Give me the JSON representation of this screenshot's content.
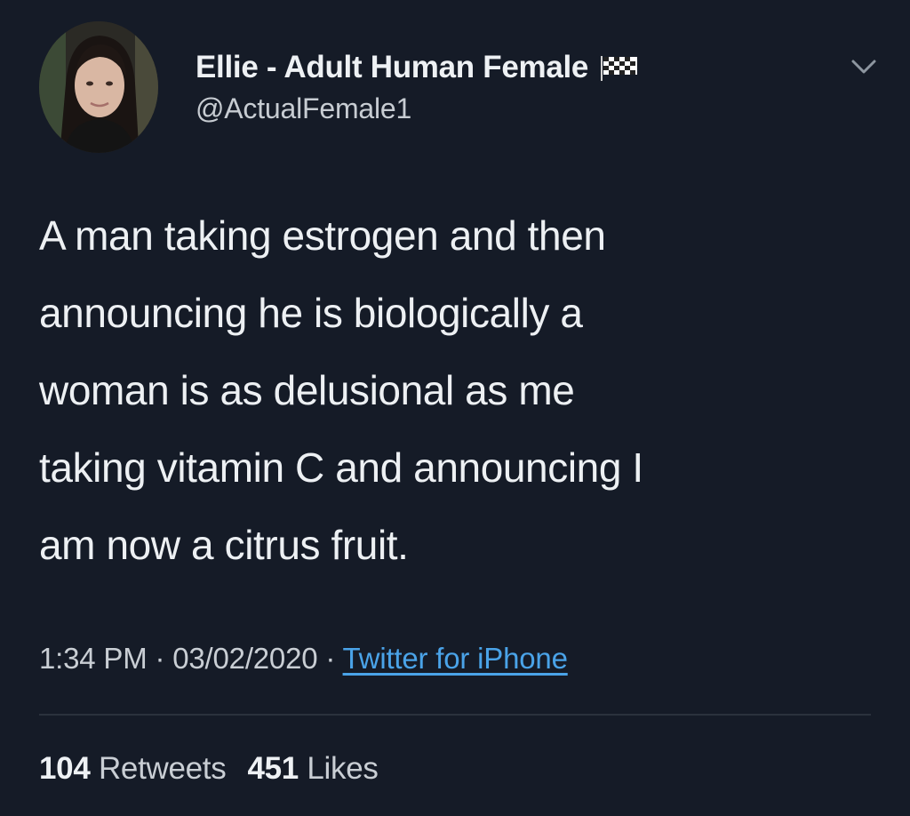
{
  "user": {
    "display_name": "Ellie - Adult Human Female",
    "handle": "@ActualFemale1",
    "flag_icon": "checkered-flag-icon",
    "menu_icon": "chevron-down-icon"
  },
  "tweet": {
    "text": "A man taking estrogen and then\nannouncing he is biologically a\nwoman is as delusional as me\ntaking vitamin C and announcing I\nam now a citrus fruit.",
    "time": "1:34 PM",
    "separator": "·",
    "date": "03/02/2020",
    "source": "Twitter for iPhone"
  },
  "stats": {
    "retweets_count": "104",
    "retweets_label": "Retweets",
    "likes_count": "451",
    "likes_label": "Likes"
  },
  "colors": {
    "background": "#151b27",
    "link": "#4aa3e8",
    "text_primary": "#edf0f3",
    "text_secondary": "#c9ced4"
  }
}
